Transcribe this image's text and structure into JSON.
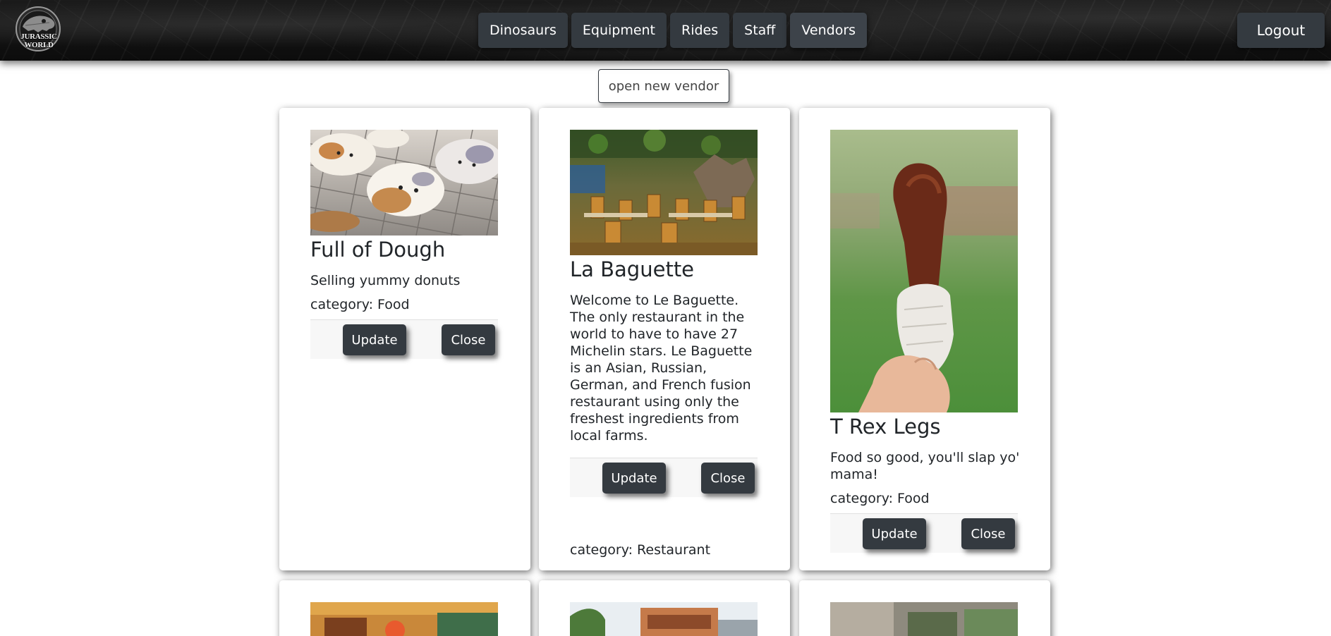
{
  "brand": {
    "logo_text": "JURASSIC WORLD"
  },
  "nav": {
    "items": [
      {
        "label": "Dinosaurs",
        "active": false
      },
      {
        "label": "Equipment",
        "active": false
      },
      {
        "label": "Rides",
        "active": false
      },
      {
        "label": "Staff",
        "active": false
      },
      {
        "label": "Vendors",
        "active": true
      }
    ],
    "logout_label": "Logout"
  },
  "actions": {
    "open_vendor_label": "open new vendor"
  },
  "vendors": [
    {
      "name": "Full of Dough",
      "description": "Selling yummy donuts",
      "category": "category: Food",
      "update_label": "Update",
      "close_label": "Close",
      "image": "donuts-photo"
    },
    {
      "name": "La Baguette",
      "description": "Welcome to Le Baguette. The only restaurant in the world to have to have 27 Michelin stars. Le Baguette is an Asian, Russian, German, and French fusion restaurant using only the freshest ingredients from local farms.",
      "category": "category: Restaurant",
      "update_label": "Update",
      "close_label": "Close",
      "image": "restaurant-interior-photo"
    },
    {
      "name": "T Rex Legs",
      "description": "Food so good, you'll slap yo' mama!",
      "category": "category: Food",
      "update_label": "Update",
      "close_label": "Close",
      "image": "turkey-leg-photo"
    }
  ],
  "colors": {
    "button_dark": "#343a40",
    "navbar_bg": "#111111",
    "card_bg": "#ffffff",
    "footer_bg": "#f7f7f7"
  }
}
